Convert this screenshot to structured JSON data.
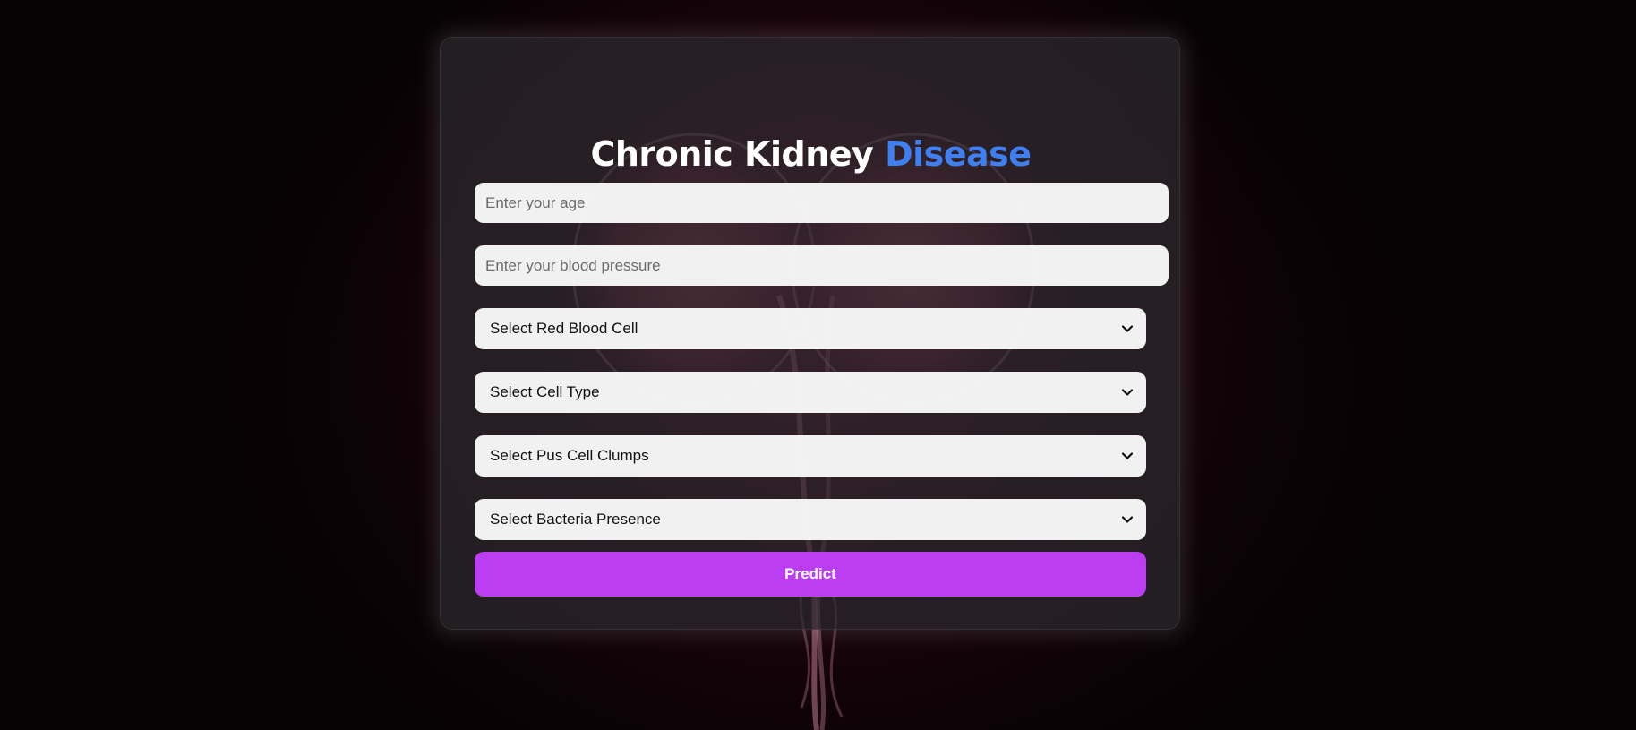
{
  "form": {
    "title_main": "Chronic Kidney ",
    "title_accent": "Disease",
    "age_placeholder": "Enter your age",
    "bp_placeholder": "Enter your blood pressure",
    "rbc_label": "Select Red Blood Cell",
    "cell_type_label": "Select Cell Type",
    "pus_clumps_label": "Select Pus Cell Clumps",
    "bacteria_label": "Select Bacteria Presence",
    "predict_label": "Predict"
  },
  "colors": {
    "accent_blue": "#3f7fef",
    "button_purple": "#bb3ef2"
  },
  "icons": {
    "select_indicator": "chevron-down-icon"
  }
}
